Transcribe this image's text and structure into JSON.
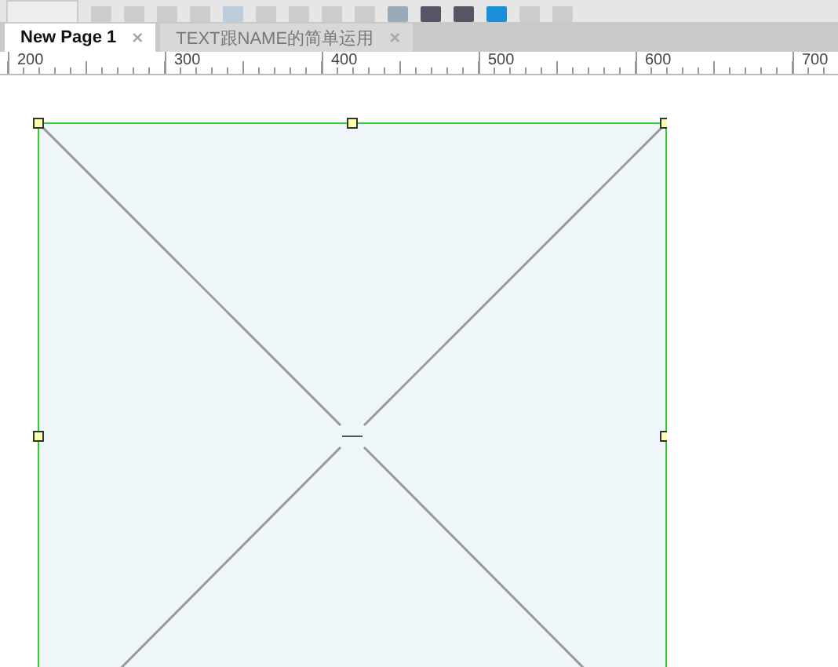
{
  "tabs": [
    {
      "label": "New Page 1",
      "close": "×",
      "selected": true
    },
    {
      "label": "TEXT跟NAME的简单运用",
      "close": "×",
      "selected": false
    }
  ],
  "ruler": {
    "labels": [
      "200",
      "300",
      "400",
      "500",
      "600",
      "700"
    ]
  },
  "canvas": {
    "widgets": [
      {
        "kind": "image",
        "selected": true
      }
    ]
  }
}
